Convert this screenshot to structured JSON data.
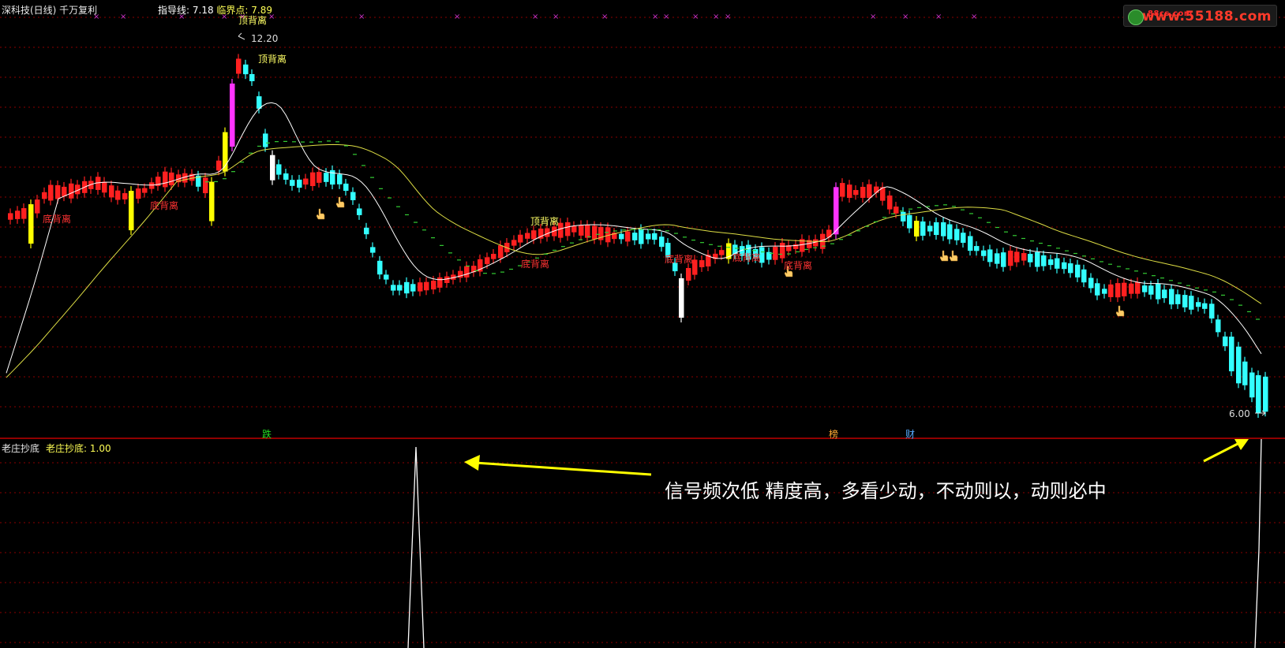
{
  "main": {
    "title": "深科技(日线) 千万复利",
    "guide_label": "指导线:",
    "guide_value": "7.18",
    "critical_label": "临界点:",
    "critical_value": "7.89",
    "high_label": "12.20",
    "low_label": "6.00",
    "news_markers": [
      {
        "text": "跌",
        "color": "#22dd22"
      },
      {
        "text": "榜",
        "color": "#ffaa33"
      },
      {
        "text": "财",
        "color": "#55aaff"
      }
    ],
    "divergence_labels": [
      {
        "text": "顶背离",
        "color": "#ffff66"
      },
      {
        "text": "顶背离",
        "color": "#ffff66"
      },
      {
        "text": "底背离",
        "color": "#ff3333"
      },
      {
        "text": "底背离",
        "color": "#ff3333"
      },
      {
        "text": "顶背离",
        "color": "#ffff66"
      },
      {
        "text": "底背离",
        "color": "#ff3333"
      },
      {
        "text": "底背离",
        "color": "#ff3333"
      },
      {
        "text": "底背离",
        "color": "#ff3333"
      },
      {
        "text": "底背离",
        "color": "#ff3333"
      }
    ],
    "colors": {
      "up": "#ff2020",
      "down": "#33ffff",
      "signal_yellow": "#ffff00",
      "signal_magenta": "#ff33ff",
      "signal_white": "#ffffff",
      "ma_white": "#ffffff",
      "ma_yellow": "#dddd44",
      "ma_green": "#33cc33",
      "grid": "#8b0000"
    }
  },
  "sub": {
    "title": "老庄抄底",
    "indicator_label": "老庄抄底:",
    "indicator_value": "1.00",
    "annotation": "信号频次低 精度高，多看少动，不动则以，动则必中"
  },
  "watermark": {
    "text": "www.55188.com",
    "small_text": "88cs.com"
  },
  "icons": [
    "pointing-hand-icon",
    "crosshair-marker-icon",
    "arrow-icon"
  ]
}
